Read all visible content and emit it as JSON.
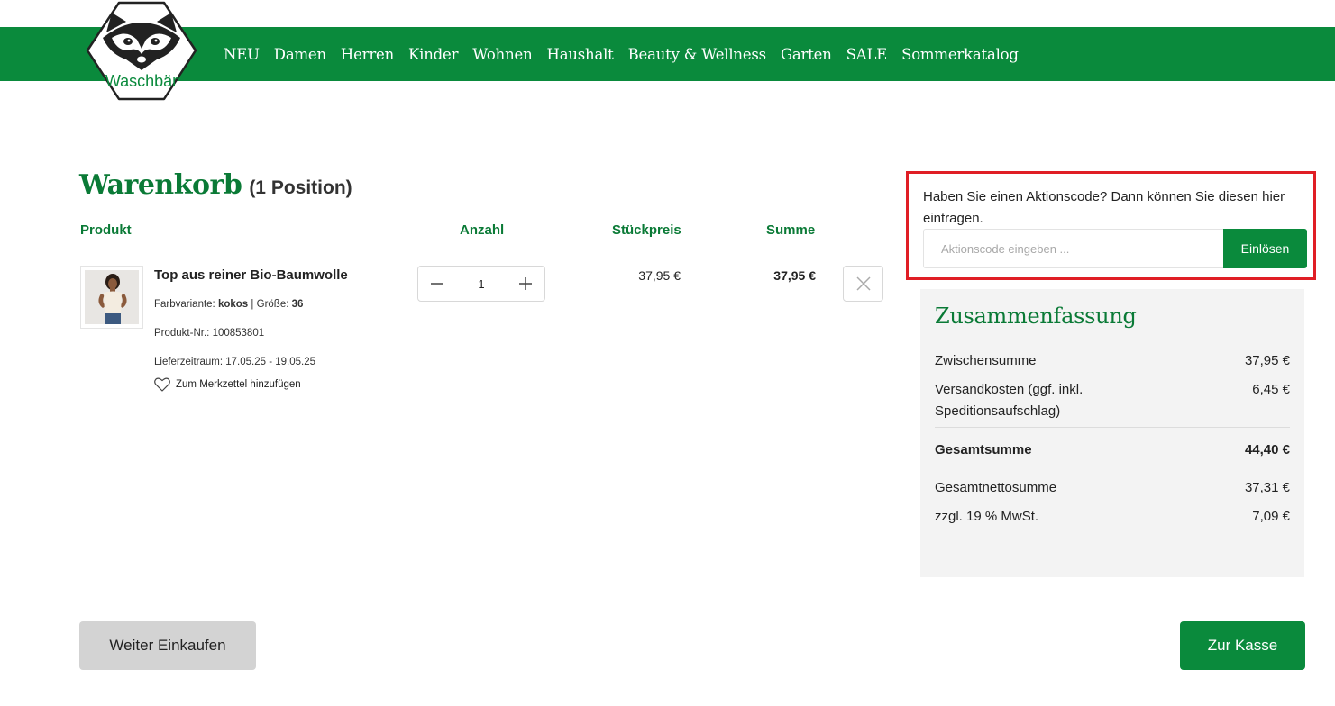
{
  "brand": {
    "name": "Waschbär",
    "accent_color": "#0a8a3c",
    "highlight_color": "#e01e25"
  },
  "nav": {
    "items": [
      "NEU",
      "Damen",
      "Herren",
      "Kinder",
      "Wohnen",
      "Haushalt",
      "Beauty & Wellness",
      "Garten",
      "SALE",
      "Sommerkatalog"
    ]
  },
  "cart": {
    "title": "Warenkorb",
    "count_label": "(1 Position)",
    "headers": {
      "product": "Produkt",
      "quantity": "Anzahl",
      "unit_price": "Stückpreis",
      "total": "Summe"
    },
    "item": {
      "name": "Top aus reiner Bio-Baumwolle",
      "color_label": "Farbvariante:",
      "color_value": "kokos",
      "separator": "|",
      "size_label": "Größe:",
      "size_value": "36",
      "sku_label": "Produkt-Nr.:",
      "sku_value": "100853801",
      "delivery_label": "Lieferzeitraum:",
      "delivery_value": "17.05.25 - 19.05.25",
      "wishlist_label": "Zum Merkzettel hinzufügen",
      "quantity": "1",
      "unit_price": "37,95 €",
      "line_total": "37,95 €"
    }
  },
  "promo": {
    "text": "Haben Sie einen Aktionscode? Dann können Sie diesen hier eintragen.",
    "placeholder": "Aktionscode eingeben ...",
    "button": "Einlösen"
  },
  "summary": {
    "title": "Zusammenfassung",
    "subtotal_label": "Zwischensumme",
    "subtotal_value": "37,95 €",
    "shipping_label": "Versandkosten (ggf. inkl. Speditionsaufschlag)",
    "shipping_value": "6,45 €",
    "total_label": "Gesamtsumme",
    "total_value": "44,40 €",
    "net_label": "Gesamtnettosumme",
    "net_value": "37,31 €",
    "vat_label": "zzgl. 19 % MwSt.",
    "vat_value": "7,09 €"
  },
  "actions": {
    "continue": "Weiter Einkaufen",
    "checkout": "Zur Kasse"
  }
}
